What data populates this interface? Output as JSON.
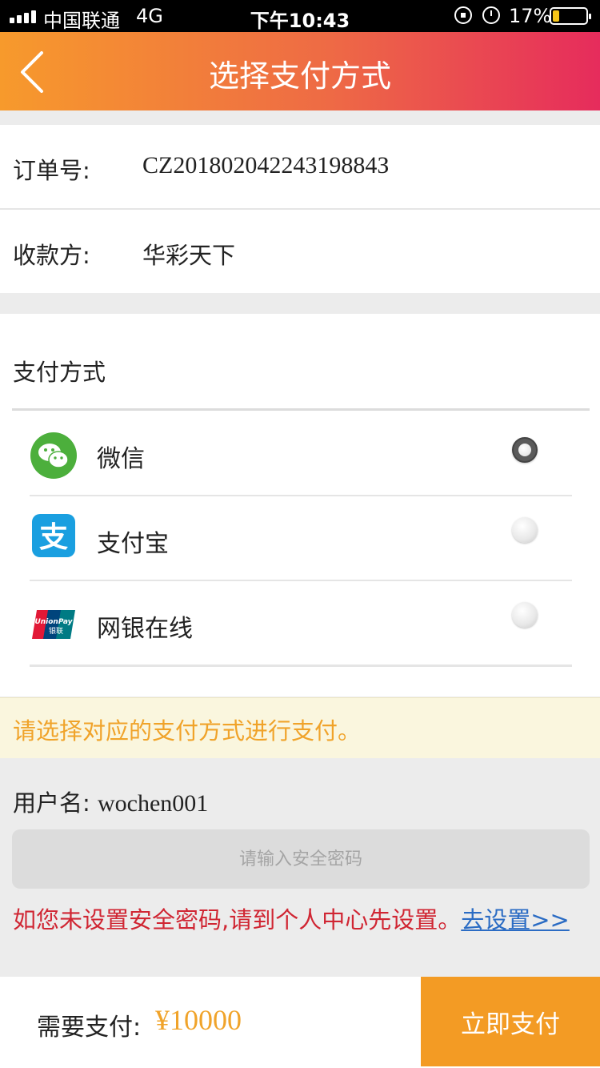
{
  "status_bar": {
    "carrier": "中国联通",
    "network": "4G",
    "time": "下午10:43",
    "battery": "17%"
  },
  "nav": {
    "title": "选择支付方式",
    "back_icon": "chevron-left-icon"
  },
  "order": {
    "order_label": "订单号:",
    "order_value": "CZ20180204224319884З",
    "payee_label": "收款方:",
    "payee_value": "华彩天下"
  },
  "payment": {
    "section_title": "支付方式",
    "methods": [
      {
        "label": "微信",
        "icon": "wechat-icon",
        "selected": true
      },
      {
        "label": "支付宝",
        "icon": "alipay-icon",
        "selected": false
      },
      {
        "label": "网银在线",
        "icon": "unionpay-icon",
        "selected": false
      }
    ]
  },
  "notice": "请选择对应的支付方式进行支付。",
  "account": {
    "username_label": "用户名:",
    "username_value": "wochen001",
    "password_placeholder": "请输入安全密码",
    "warning_text": "如您未设置安全密码,请到个人中心先设置。",
    "setup_link": "去设置>>"
  },
  "footer": {
    "amount_label": "需要支付:",
    "amount_value": "¥10000",
    "pay_button": "立即支付"
  },
  "colors": {
    "accent_orange": "#f39b24",
    "amount_color": "#f0a32a",
    "warning_red": "#d02633",
    "link_blue": "#2b6cc4",
    "notice_bg": "#faf6de"
  }
}
